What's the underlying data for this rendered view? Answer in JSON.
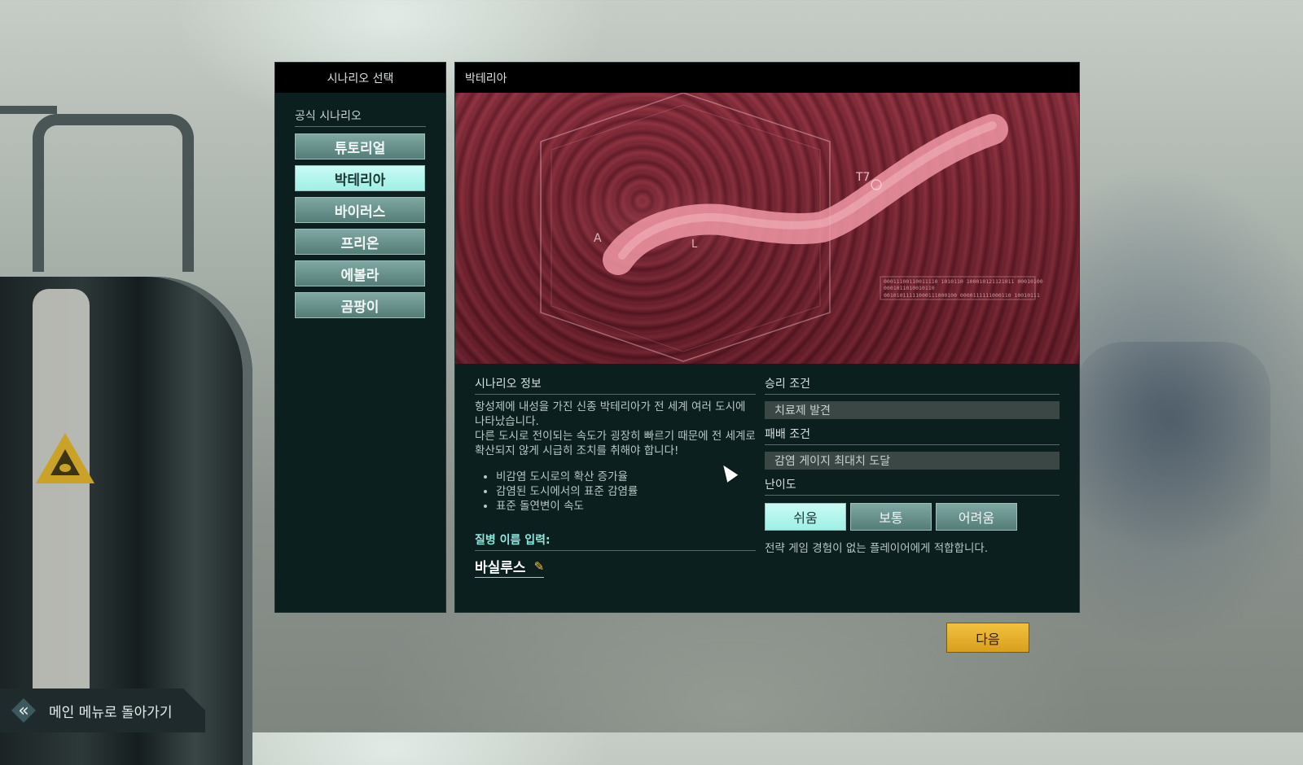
{
  "sidebar": {
    "title": "시나리오 선택",
    "section_label": "공식 시나리오",
    "items": [
      {
        "label": "튜토리얼"
      },
      {
        "label": "박테리아"
      },
      {
        "label": "바이러스"
      },
      {
        "label": "프리온"
      },
      {
        "label": "에볼라"
      },
      {
        "label": "곰팡이"
      }
    ],
    "selected_index": 1
  },
  "detail": {
    "title": "박테리아",
    "image_labels": {
      "a": "A",
      "l": "L",
      "t7": "T7"
    },
    "image_data_text": [
      "00011100110011110 1010110 100010121121011 00010100",
      "0001011010010110",
      "00101011111000111000100 0000111111000110 10010111"
    ],
    "info_title": "시나리오 정보",
    "description_1": "항성제에 내성을 가진 신종 박테리아가 전 세계 여러 도시에 나타났습니다.",
    "description_2": "다른 도시로 전이되는 속도가 굉장히 빠르기 때문에 전 세계로 확산되지 않게 시급히 조치를 취해야 합니다!",
    "bullets": [
      "비감염 도시로의 확산 증가율",
      "감염된 도시에서의 표준 감염률",
      "표준 돌연변이 속도"
    ],
    "name_label": "질병 이름 입력:",
    "disease_name": "바실루스",
    "victory_title": "승리 조건",
    "victory_value": "치료제 발견",
    "defeat_title": "패배 조건",
    "defeat_value": "감염 게이지 최대치 도달",
    "difficulty_title": "난이도",
    "difficulties": [
      {
        "label": "쉬움"
      },
      {
        "label": "보통"
      },
      {
        "label": "어려움"
      }
    ],
    "difficulty_selected": 0,
    "difficulty_description": "전략 게임 경험이 없는 플레이어에게 적합합니다."
  },
  "next_label": "다음",
  "back_label": "메인 메뉴로 돌아가기",
  "colors": {
    "accent": "#9ef0e6",
    "button": "#6a938e",
    "next": "#e6b12c",
    "panel": "#0a1f1e"
  }
}
